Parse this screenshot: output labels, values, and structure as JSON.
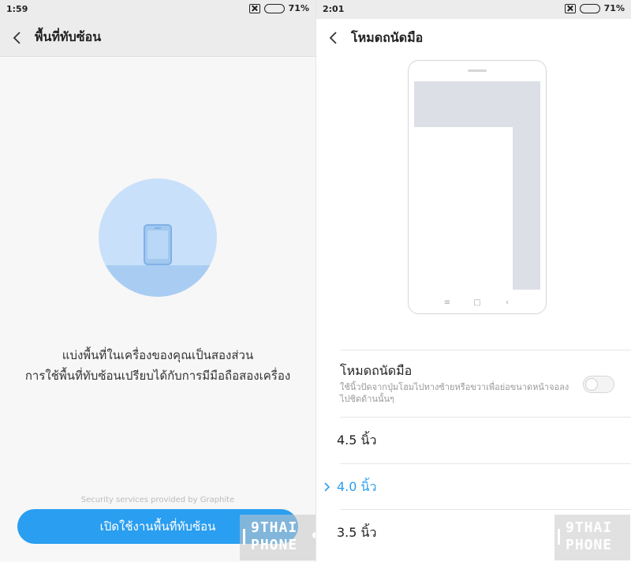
{
  "left_screen": {
    "status": {
      "time": "1:59",
      "battery": "71%",
      "battery_level": 0.71
    },
    "title": "พื้นที่ทับซ้อน",
    "description_line1": "แบ่งพื้นที่ในเครื่องของคุณเป็นสองส่วน",
    "description_line2": "การใช้พื้นที่ทับซ้อนเปรียบได้กับการมีมือถือสองเครื่อง",
    "provided_by": "Security services provided by Graphite",
    "enable_button": "เปิดใช้งานพื้นที่ทับซ้อน"
  },
  "right_screen": {
    "status": {
      "time": "2:01",
      "battery": "71%",
      "battery_level": 0.71
    },
    "title": "โหมดถนัดมือ",
    "setting": {
      "title": "โหมดถนัดมือ",
      "description": "ใช้นิ้วปัดจากปุ่มโฮมไปทางซ้ายหรือขวาเพื่อย่อขนาดหน้าจอลงไปชิดด้านนั้นๆ",
      "enabled": false
    },
    "phone_nav": {
      "menu": "≡",
      "home": "□",
      "back": "‹"
    },
    "sizes": [
      {
        "label": "4.5 นิ้ว",
        "selected": false
      },
      {
        "label": "4.0 นิ้ว",
        "selected": true
      },
      {
        "label": "3.5 นิ้ว",
        "selected": false
      }
    ]
  },
  "watermark": {
    "line1": "9THAI",
    "line2": "PHONE"
  },
  "colors": {
    "accent": "#2a9ef0",
    "circle": "#c9e0fa",
    "header": "#ececec"
  }
}
